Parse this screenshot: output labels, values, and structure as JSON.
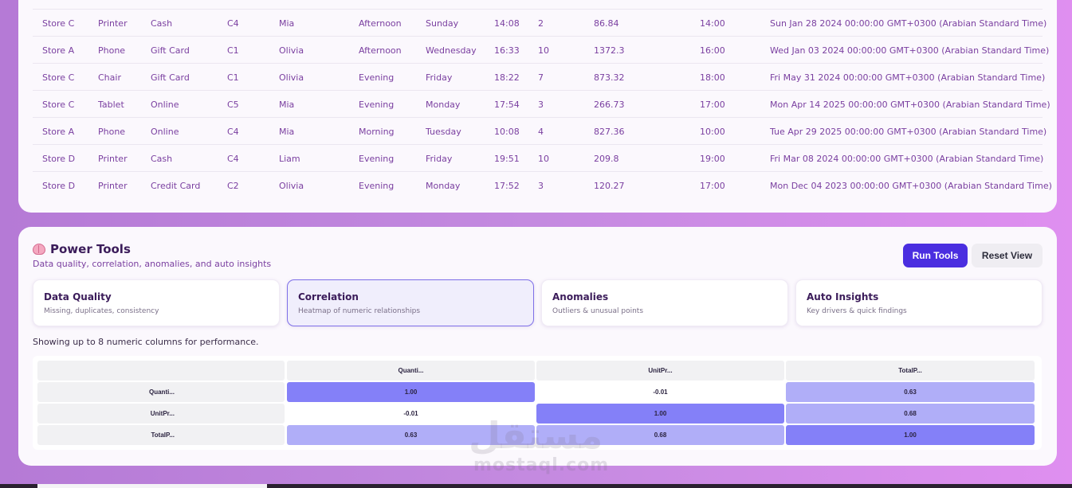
{
  "table": {
    "rows": [
      [
        "Store C",
        "Printer",
        "Cash",
        "C4",
        "Mia",
        "Afternoon",
        "Sunday",
        "14:08",
        "2",
        "86.84",
        "14:00",
        "Sun Jan 28 2024 00:00:00 GMT+0300 (Arabian Standard Time)"
      ],
      [
        "Store A",
        "Phone",
        "Gift Card",
        "C1",
        "Olivia",
        "Afternoon",
        "Wednesday",
        "16:33",
        "10",
        "1372.3",
        "16:00",
        "Wed Jan 03 2024 00:00:00 GMT+0300 (Arabian Standard Time)"
      ],
      [
        "Store C",
        "Chair",
        "Gift Card",
        "C1",
        "Olivia",
        "Evening",
        "Friday",
        "18:22",
        "7",
        "873.32",
        "18:00",
        "Fri May 31 2024 00:00:00 GMT+0300 (Arabian Standard Time)"
      ],
      [
        "Store C",
        "Tablet",
        "Online",
        "C5",
        "Mia",
        "Evening",
        "Monday",
        "17:54",
        "3",
        "266.73",
        "17:00",
        "Mon Apr 14 2025 00:00:00 GMT+0300 (Arabian Standard Time)"
      ],
      [
        "Store A",
        "Phone",
        "Online",
        "C4",
        "Mia",
        "Morning",
        "Tuesday",
        "10:08",
        "4",
        "827.36",
        "10:00",
        "Tue Apr 29 2025 00:00:00 GMT+0300 (Arabian Standard Time)"
      ],
      [
        "Store D",
        "Printer",
        "Cash",
        "C4",
        "Liam",
        "Evening",
        "Friday",
        "19:51",
        "10",
        "209.8",
        "19:00",
        "Fri Mar 08 2024 00:00:00 GMT+0300 (Arabian Standard Time)"
      ],
      [
        "Store D",
        "Printer",
        "Credit Card",
        "C2",
        "Olivia",
        "Evening",
        "Monday",
        "17:52",
        "3",
        "120.27",
        "17:00",
        "Mon Dec 04 2023 00:00:00 GMT+0300 (Arabian Standard Time)"
      ]
    ]
  },
  "power_tools": {
    "title": "Power Tools",
    "icon": "brain-icon",
    "subtitle": "Data quality, correlation, anomalies, and auto insights",
    "run_label": "Run Tools",
    "reset_label": "Reset View",
    "tabs": [
      {
        "name": "Data Quality",
        "desc": "Missing, duplicates, consistency",
        "active": false
      },
      {
        "name": "Correlation",
        "desc": "Heatmap of numeric relationships",
        "active": true
      },
      {
        "name": "Anomalies",
        "desc": "Outliers & unusual points",
        "active": false
      },
      {
        "name": "Auto Insights",
        "desc": "Key drivers & quick findings",
        "active": false
      }
    ],
    "note": "Showing up to 8 numeric columns for performance.",
    "heatmap": {
      "columns": [
        "Quanti...",
        "UnitPr...",
        "TotalP..."
      ],
      "rows": [
        {
          "label": "Quanti...",
          "values": [
            "1.00",
            "-0.01",
            "0.63"
          ]
        },
        {
          "label": "UnitPr...",
          "values": [
            "-0.01",
            "1.00",
            "0.68"
          ]
        },
        {
          "label": "TotalP...",
          "values": [
            "0.63",
            "0.68",
            "1.00"
          ]
        }
      ]
    },
    "colors": {
      "accent": "#4a2ee0",
      "heat_strong": "#8480f8",
      "heat_mid": "#b0aef8",
      "heat_none": "#ffffff"
    }
  },
  "watermark": {
    "arabic": "مستقل",
    "latin": "mostaql.com"
  }
}
